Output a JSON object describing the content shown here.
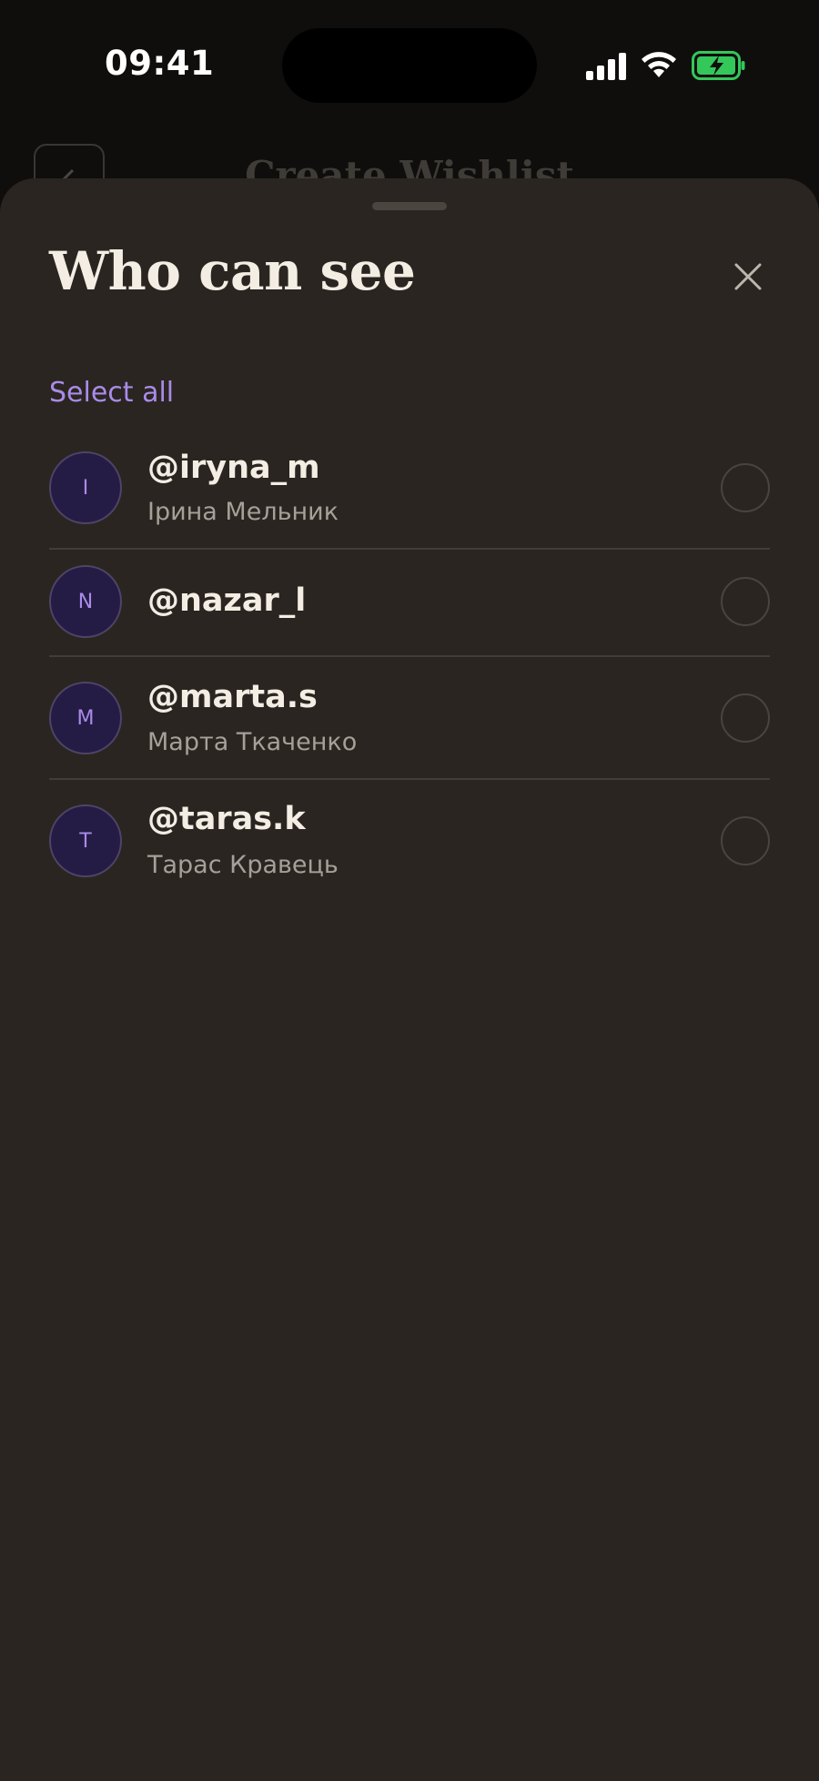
{
  "status_bar": {
    "time": "09:41"
  },
  "background": {
    "title": "Create Wishlist"
  },
  "sheet": {
    "title": "Who can see",
    "select_all": "Select all",
    "friends": [
      {
        "initial": "I",
        "username": "@iryna_m",
        "name": "Ірина Мельник",
        "selected": false
      },
      {
        "initial": "N",
        "username": "@nazar_l",
        "name": "",
        "selected": false
      },
      {
        "initial": "M",
        "username": "@marta.s",
        "name": "Марта Ткаченко",
        "selected": false
      },
      {
        "initial": "T",
        "username": "@taras.k",
        "name": "Тарас Кравець",
        "selected": false
      }
    ]
  },
  "colors": {
    "sheet_bg": "#2a2520",
    "accent": "#a98be8",
    "avatar_bg": "#251c45",
    "battery_green": "#34c759"
  },
  "icons": [
    "signal-icon",
    "wifi-icon",
    "battery-charging-icon",
    "chevron-left-icon",
    "close-icon"
  ]
}
